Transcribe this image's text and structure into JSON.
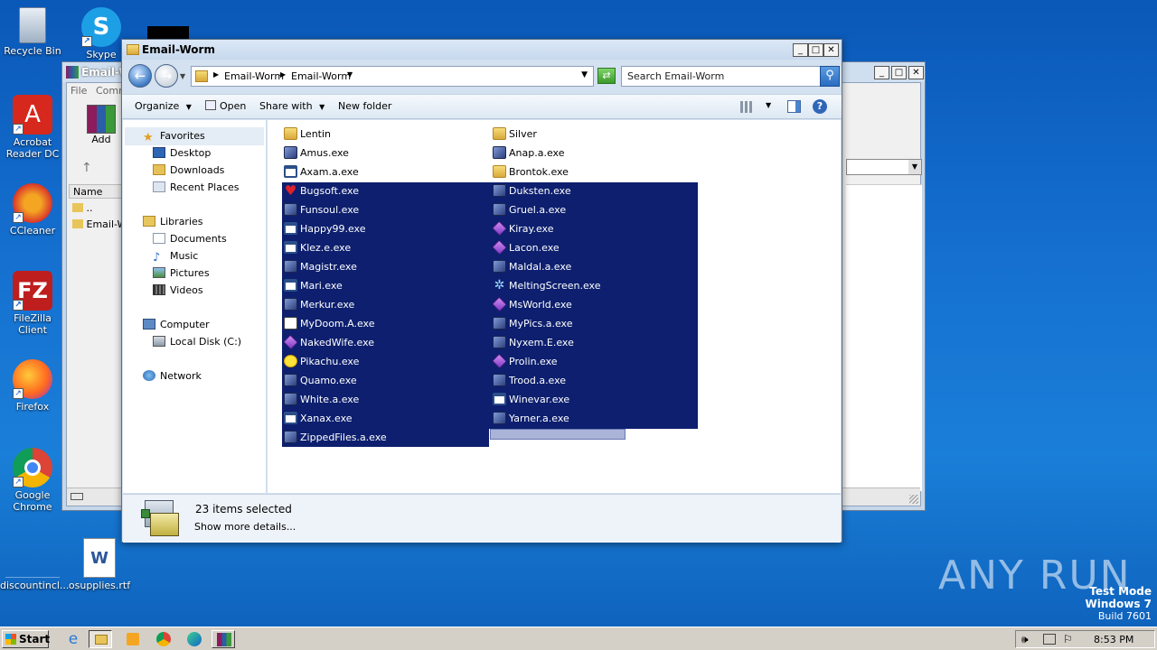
{
  "desktop": {
    "icons": [
      {
        "label": "Recycle Bin"
      },
      {
        "label": "Skype"
      },
      {
        "label": "Acrobat Reader DC"
      },
      {
        "label": "CCleaner"
      },
      {
        "label": "FileZilla Client"
      },
      {
        "label": "Firefox"
      },
      {
        "label": "Google Chrome"
      },
      {
        "label": "discountincl..."
      },
      {
        "label": "osupplies.rtf"
      }
    ],
    "watermark": "ANY RUN",
    "test_mode": {
      "line1": "Test Mode",
      "line2": "Windows 7",
      "line3": "Build 7601"
    }
  },
  "back_window": {
    "title": "Email-W",
    "menu": [
      "File",
      "Comm"
    ],
    "add_label": "Add",
    "col_name": "Name",
    "rows": [
      "..",
      "Email-W"
    ]
  },
  "explorer": {
    "title": "Email-Worm",
    "breadcrumb": [
      "Email-Worm",
      "Email-Worm"
    ],
    "search_placeholder": "Search Email-Worm",
    "toolbar": {
      "organize": "Organize",
      "open": "Open",
      "share_with": "Share with",
      "new_folder": "New folder"
    },
    "nav": {
      "favorites": "Favorites",
      "desktop": "Desktop",
      "downloads": "Downloads",
      "recent": "Recent Places",
      "libraries": "Libraries",
      "documents": "Documents",
      "music": "Music",
      "pictures": "Pictures",
      "videos": "Videos",
      "computer": "Computer",
      "local_disk": "Local Disk (C:)",
      "network": "Network"
    },
    "files_col1": [
      {
        "name": "Lentin",
        "icon": "folder-icon",
        "selected": false
      },
      {
        "name": "Amus.exe",
        "icon": "exe-icon",
        "selected": false
      },
      {
        "name": "Axam.a.exe",
        "icon": "window-exe-icon",
        "selected": false
      },
      {
        "name": "Bugsoft.exe",
        "icon": "heart-icon",
        "selected": true
      },
      {
        "name": "Funsoul.exe",
        "icon": "exe-icon",
        "selected": true
      },
      {
        "name": "Happy99.exe",
        "icon": "window-exe-icon",
        "selected": true
      },
      {
        "name": "Klez.e.exe",
        "icon": "window-exe-icon",
        "selected": true
      },
      {
        "name": "Magistr.exe",
        "icon": "exe-icon",
        "selected": true
      },
      {
        "name": "Mari.exe",
        "icon": "window-exe-icon",
        "selected": true
      },
      {
        "name": "Merkur.exe",
        "icon": "exe-icon",
        "selected": true
      },
      {
        "name": "MyDoom.A.exe",
        "icon": "doc-exe-icon",
        "selected": true
      },
      {
        "name": "NakedWife.exe",
        "icon": "diamond-icon",
        "selected": true
      },
      {
        "name": "Pikachu.exe",
        "icon": "smiley-icon",
        "selected": true
      },
      {
        "name": "Quamo.exe",
        "icon": "exe-icon",
        "selected": true
      },
      {
        "name": "White.a.exe",
        "icon": "exe-icon",
        "selected": true
      },
      {
        "name": "Xanax.exe",
        "icon": "window-exe-icon",
        "selected": true
      },
      {
        "name": "ZippedFiles.a.exe",
        "icon": "exe-icon",
        "selected": true
      }
    ],
    "files_col2": [
      {
        "name": "Silver",
        "icon": "folder-icon",
        "selected": false
      },
      {
        "name": "Anap.a.exe",
        "icon": "exe-icon",
        "selected": false
      },
      {
        "name": "Brontok.exe",
        "icon": "folder-icon",
        "selected": false
      },
      {
        "name": "Duksten.exe",
        "icon": "exe-icon",
        "selected": true
      },
      {
        "name": "Gruel.a.exe",
        "icon": "exe-icon",
        "selected": true
      },
      {
        "name": "Kiray.exe",
        "icon": "diamond-icon",
        "selected": true
      },
      {
        "name": "Lacon.exe",
        "icon": "diamond-icon",
        "selected": true
      },
      {
        "name": "Maldal.a.exe",
        "icon": "exe-icon",
        "selected": true
      },
      {
        "name": "MeltingScreen.exe",
        "icon": "snowflake-icon",
        "selected": true
      },
      {
        "name": "MsWorld.exe",
        "icon": "diamond-icon",
        "selected": true
      },
      {
        "name": "MyPics.a.exe",
        "icon": "exe-icon",
        "selected": true
      },
      {
        "name": "Nyxem.E.exe",
        "icon": "exe-icon",
        "selected": true
      },
      {
        "name": "Prolin.exe",
        "icon": "diamond-icon",
        "selected": true
      },
      {
        "name": "Trood.a.exe",
        "icon": "exe-icon",
        "selected": true
      },
      {
        "name": "Winevar.exe",
        "icon": "window-exe-icon",
        "selected": true
      },
      {
        "name": "Yarner.a.exe",
        "icon": "exe-icon",
        "selected": true
      }
    ],
    "status": {
      "count": "23 items selected",
      "details": "Show more details..."
    }
  },
  "taskbar": {
    "start": "Start",
    "clock": "8:53 PM"
  },
  "colors": {
    "selection": "#0d1f6e",
    "desktop": "#1570d0"
  }
}
